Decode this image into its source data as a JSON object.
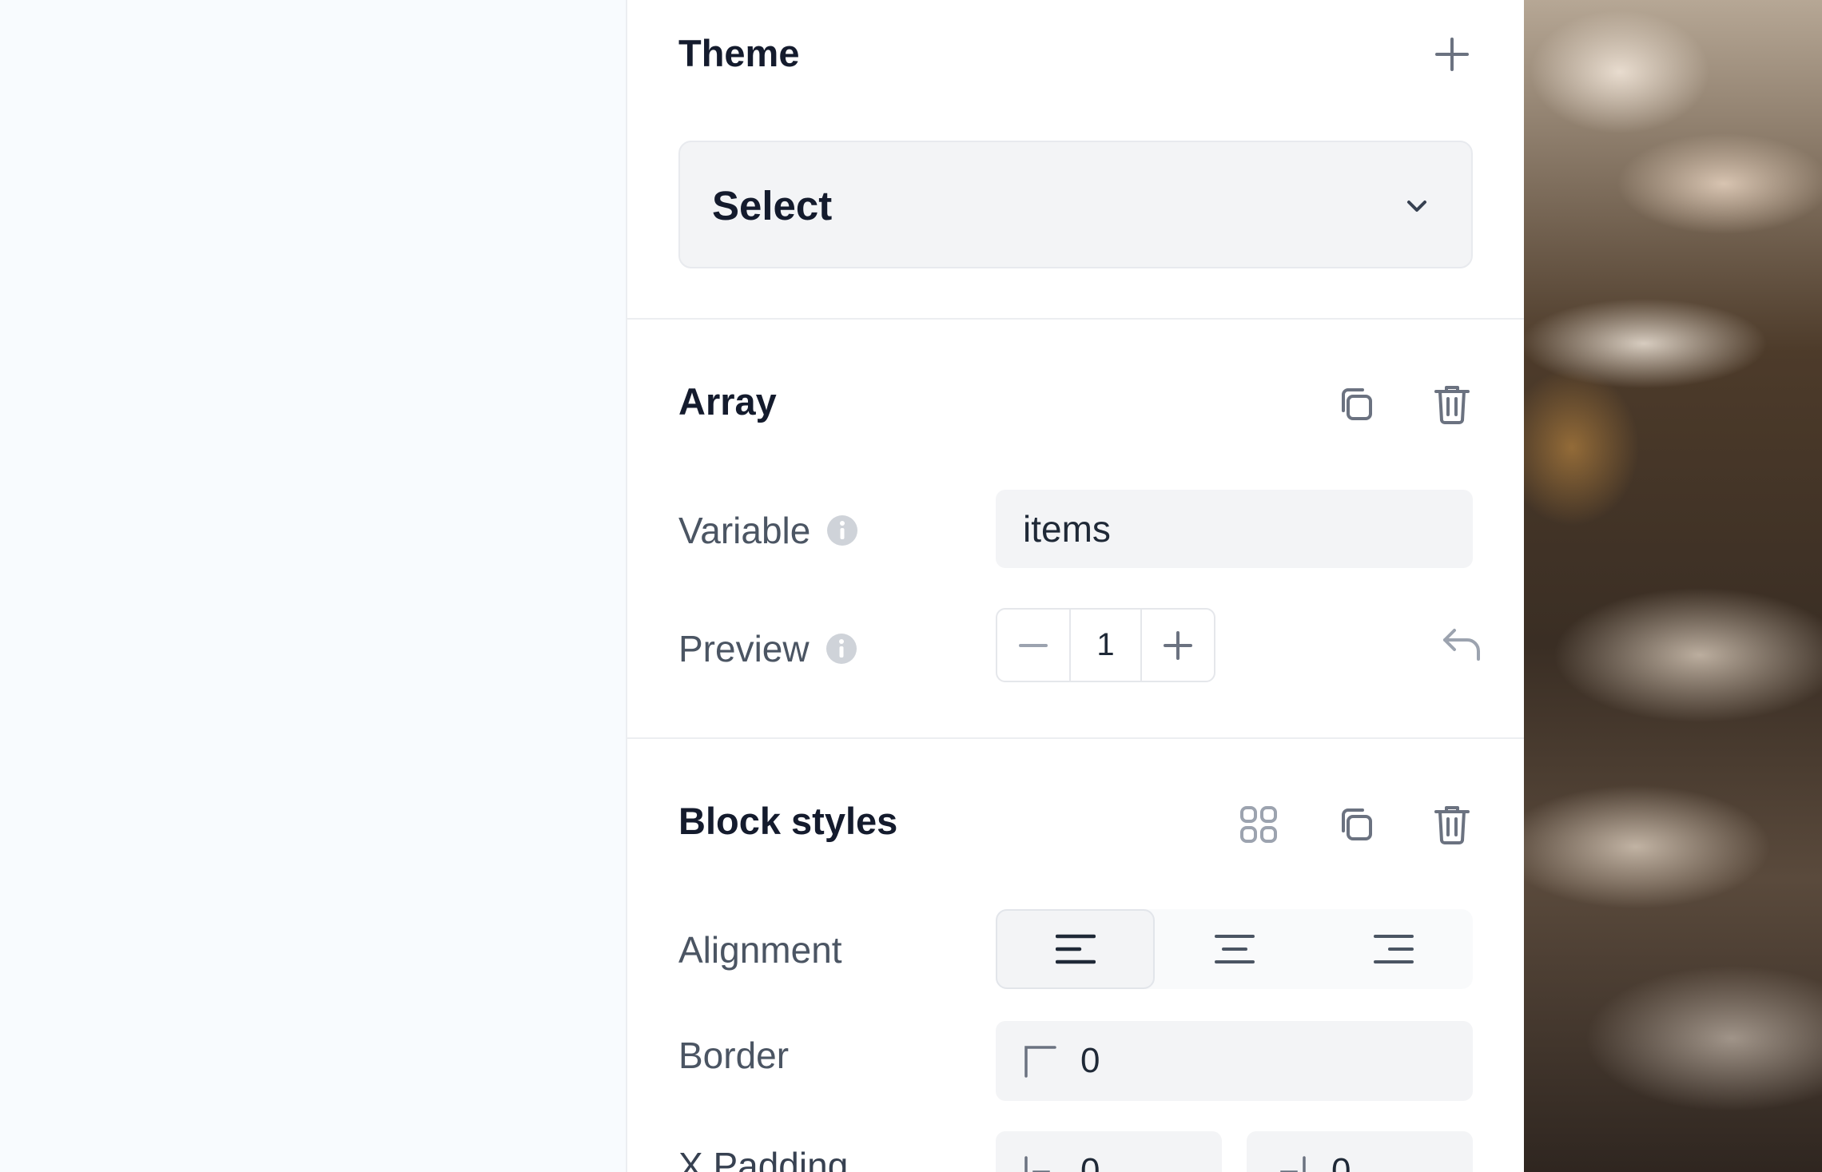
{
  "theme": {
    "title": "Theme",
    "select_value": "Select"
  },
  "array": {
    "title": "Array",
    "variable_label": "Variable",
    "variable_value": "items",
    "preview_label": "Preview",
    "preview_value": "1"
  },
  "block_styles": {
    "title": "Block styles",
    "alignment_label": "Alignment",
    "alignment_selected": "left",
    "border_label": "Border",
    "border_value": "0",
    "x_padding_label": "X Padding",
    "x_padding_left": "0",
    "x_padding_right": "0"
  },
  "colors": {
    "panel_bg": "#ffffff",
    "field_bg": "#f3f4f6",
    "heading": "#141b2d",
    "label": "#4b5563",
    "icon": "#6b7280"
  },
  "icons": [
    "plus-icon",
    "chevron-down-icon",
    "duplicate-icon",
    "trash-icon",
    "info-icon",
    "minus-icon",
    "undo-icon",
    "grid-icon",
    "align-left-icon",
    "align-center-icon",
    "align-right-icon",
    "border-corner-icon",
    "padding-left-icon",
    "padding-right-icon"
  ]
}
